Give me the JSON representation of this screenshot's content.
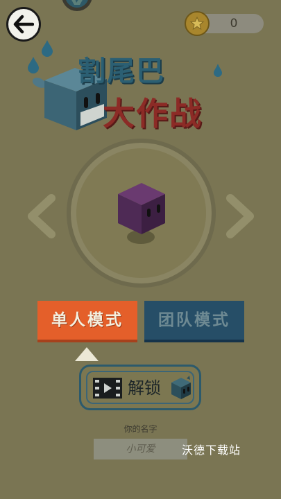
{
  "header": {
    "coins": "0"
  },
  "logo": {
    "line1": "割尾巴",
    "line2": "大作战"
  },
  "modes": {
    "single": "单人模式",
    "team": "团队模式",
    "selected": "single"
  },
  "unlock": {
    "label": "解锁"
  },
  "name": {
    "label": "你的名字",
    "placeholder": "小可爱"
  },
  "watermark": "沃德下载站",
  "colors": {
    "background": "#7a7553",
    "single_mode": "#e45f2a",
    "team_mode": "#264e67",
    "cube": "#4e2a55"
  }
}
